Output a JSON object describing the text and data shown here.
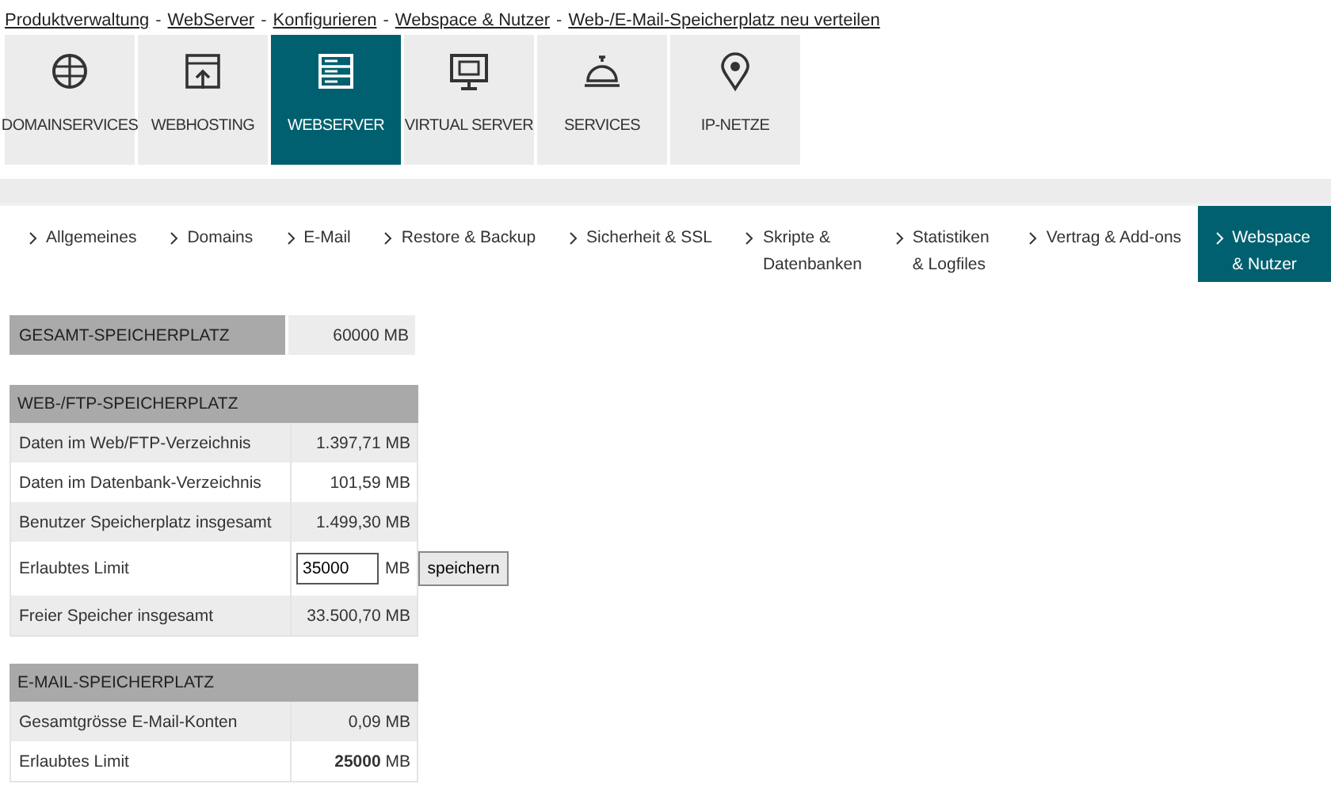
{
  "breadcrumb": {
    "separator": "-",
    "items": [
      "Produktverwaltung",
      "WebServer",
      "Konfigurieren",
      "Webspace & Nutzer",
      "Web-/E-Mail-Speicherplatz neu verteilen"
    ]
  },
  "main_tabs": [
    {
      "label": "DOMAINSERVICES",
      "selected": false
    },
    {
      "label": "WEBHOSTING",
      "selected": false
    },
    {
      "label": "WEBSERVER",
      "selected": true
    },
    {
      "label": "VIRTUAL SERVER",
      "selected": false
    },
    {
      "label": "SERVICES",
      "selected": false
    },
    {
      "label": "IP-NETZE",
      "selected": false
    }
  ],
  "sub_tabs": [
    {
      "label": "Allgemeines",
      "selected": false
    },
    {
      "label": "Domains",
      "selected": false
    },
    {
      "label": "E-Mail",
      "selected": false
    },
    {
      "label": "Restore & Backup",
      "selected": false
    },
    {
      "label": "Sicherheit & SSL",
      "selected": false
    },
    {
      "label": "Skripte & Datenbanken",
      "selected": false
    },
    {
      "label": "Statistiken & Logfiles",
      "selected": false
    },
    {
      "label": "Vertrag & Add-ons",
      "selected": false
    },
    {
      "label": "Webspace & Nutzer",
      "selected": true
    }
  ],
  "total": {
    "label": "GESAMT-SPEICHERPLATZ",
    "value": "60000 MB"
  },
  "tables": [
    {
      "title": "WEB-/FTP-SPEICHERPLATZ",
      "rows": [
        {
          "kind": "value",
          "label": "Daten im Web/FTP-Verzeichnis",
          "value": "1.397,71 MB"
        },
        {
          "kind": "value",
          "label": "Daten im Datenbank-Verzeichnis",
          "value": "101,59 MB"
        },
        {
          "kind": "value",
          "label": "Benutzer Speicherplatz insgesamt",
          "value": "1.499,30 MB"
        },
        {
          "kind": "input",
          "label": "Erlaubtes Limit",
          "value": "35000",
          "unit": "MB",
          "button": "speichern"
        },
        {
          "kind": "value",
          "label": "Freier Speicher insgesamt",
          "value": "33.500,70 MB"
        }
      ]
    },
    {
      "title": "E-MAIL-SPEICHERPLATZ",
      "rows": [
        {
          "kind": "value",
          "label": "Gesamtgrösse E-Mail-Konten",
          "value": "0,09 MB"
        },
        {
          "kind": "value",
          "label": "Erlaubtes Limit",
          "value": "**25000** MB"
        }
      ]
    }
  ]
}
